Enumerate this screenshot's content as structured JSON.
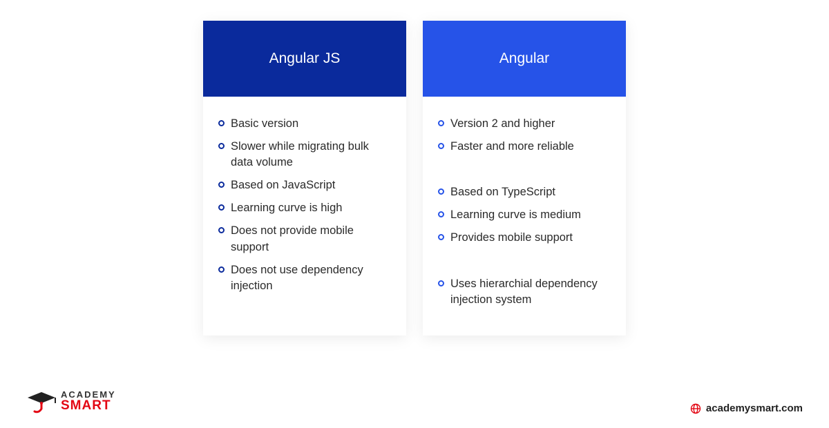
{
  "colors": {
    "header_left": "#0a2a9c",
    "header_right": "#2653e8",
    "bullet_left": "#0a2a9c",
    "bullet_right": "#2653e8",
    "accent_red": "#e30613"
  },
  "cards": [
    {
      "title": "Angular JS",
      "items": [
        "Basic version",
        "Slower while migrating bulk data volume",
        "Based on JavaScript",
        "Learning curve is high",
        "Does not provide mobile support",
        "Does not use dependency injection"
      ],
      "spacers": []
    },
    {
      "title": "Angular",
      "items": [
        "Version 2 and higher",
        "Faster and more reliable",
        "",
        "Based on TypeScript",
        "Learning curve is medium",
        "Provides mobile support",
        "",
        "Uses hierarchial dependency injection system"
      ],
      "spacers": [
        2,
        6
      ]
    }
  ],
  "footer": {
    "logo_line1": "ACADEMY",
    "logo_line2": "SMART",
    "site": "academysmart.com"
  }
}
